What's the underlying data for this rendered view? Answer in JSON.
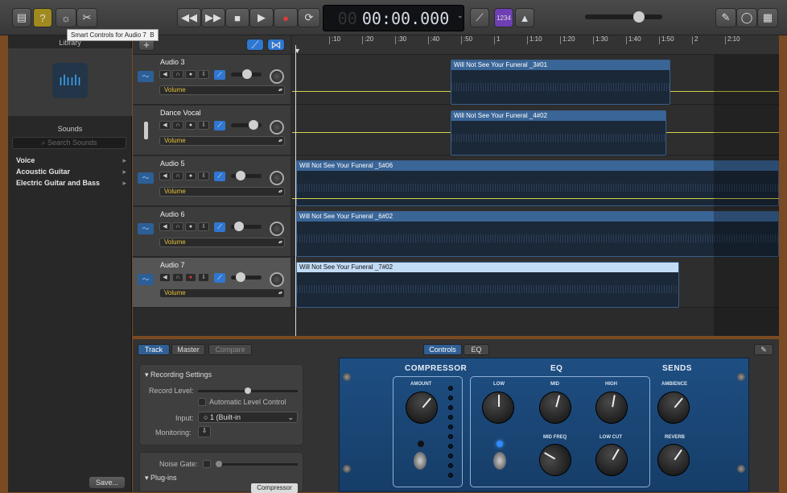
{
  "toolbar": {
    "time": "00:00.000",
    "count_in_label": "1234",
    "tooltip": "Smart Controls for Audio 7",
    "tooltip_key": "B"
  },
  "library": {
    "title": "Library",
    "sounds_title": "Sounds",
    "search_placeholder": "Search Sounds",
    "categories": [
      "Voice",
      "Acoustic Guitar",
      "Electric Guitar and Bass"
    ],
    "save_label": "Save..."
  },
  "ruler": {
    "ticks": [
      ":10",
      ":20",
      ":30",
      ":40",
      ":50",
      "1",
      "1:10",
      "1:20",
      "1:30",
      "1:40",
      "1:50",
      "2",
      "2:10"
    ]
  },
  "tracks": [
    {
      "name": "Audio 3",
      "param": "Volume",
      "region": "Will Not See Your Funeral _3#01"
    },
    {
      "name": "Dance Vocal",
      "param": "Volume",
      "region": "Will Not See Your Funeral _4#02"
    },
    {
      "name": "Audio 5",
      "param": "Volume",
      "region": "Will Not See Your Funeral _5#06"
    },
    {
      "name": "Audio 6",
      "param": "Volume",
      "region": "Will Not See Your Funeral _6#02"
    },
    {
      "name": "Audio 7",
      "param": "Volume",
      "region": "Will Not See Your Funeral _7#02"
    }
  ],
  "smart_controls": {
    "tabs": [
      "Track",
      "Master",
      "Compare"
    ],
    "view_tabs": [
      "Controls",
      "EQ"
    ],
    "recording_settings": "Recording Settings",
    "record_level": "Record Level:",
    "auto_level": "Automatic Level Control",
    "input_label": "Input:",
    "input_value": "1  (Built-in",
    "monitoring_label": "Monitoring:",
    "noise_gate": "Noise Gate:",
    "plugins": "Plug-ins",
    "compressor_slot": "Compressor"
  },
  "plugin": {
    "compressor": "COMPRESSOR",
    "eq": "EQ",
    "sends": "SENDS",
    "amount": "AMOUNT",
    "low": "LOW",
    "mid": "MID",
    "high": "HIGH",
    "mid_freq": "MID FREQ",
    "low_cut": "LOW CUT",
    "ambience": "AMBIENCE",
    "reverb": "REVERB"
  }
}
